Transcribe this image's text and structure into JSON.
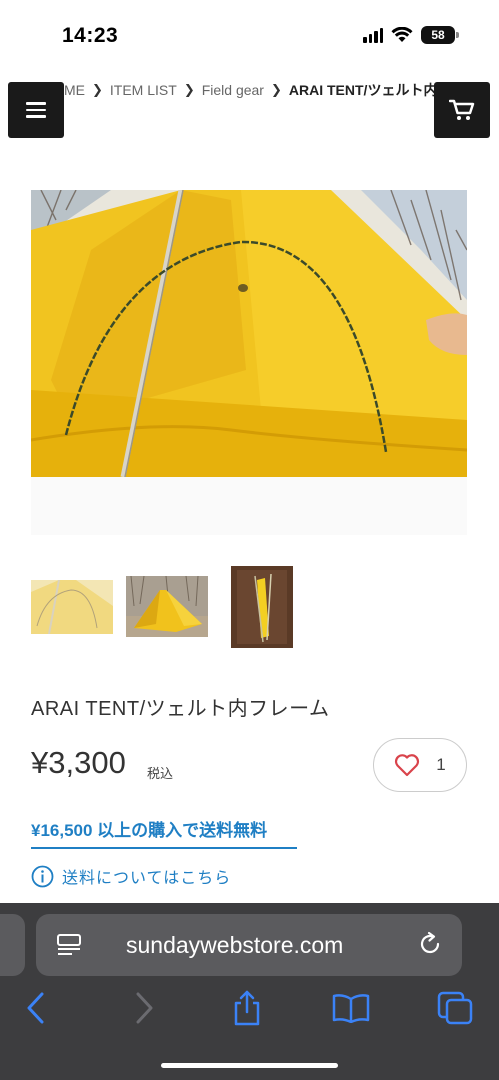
{
  "status_bar": {
    "time": "14:23",
    "battery": "58"
  },
  "breadcrumb": [
    {
      "label": "ME"
    },
    {
      "label": "ITEM LIST"
    },
    {
      "label": "Field gear"
    },
    {
      "label": "ARAI TENT/ツェルト内フレーム"
    }
  ],
  "header": {
    "menu_icon": "hamburger-icon",
    "cart_icon": "cart-icon"
  },
  "product": {
    "title": "ARAI TENT/ツェルト内フレーム",
    "price": "¥3,300",
    "tax_label": "税込",
    "favorite_count": "1",
    "shipping_banner": "¥16,500 以上の購入で送料無料",
    "shipping_info": "送料についてはこちら"
  },
  "browser": {
    "url": "sundaywebstore.com"
  },
  "colors": {
    "accent": "#1f7fc4",
    "tent_yellow": "#f2c21a",
    "dark_button": "#1a1a1a",
    "browser_bg": "#3d3d3f",
    "ios_blue": "#3b82f6"
  }
}
